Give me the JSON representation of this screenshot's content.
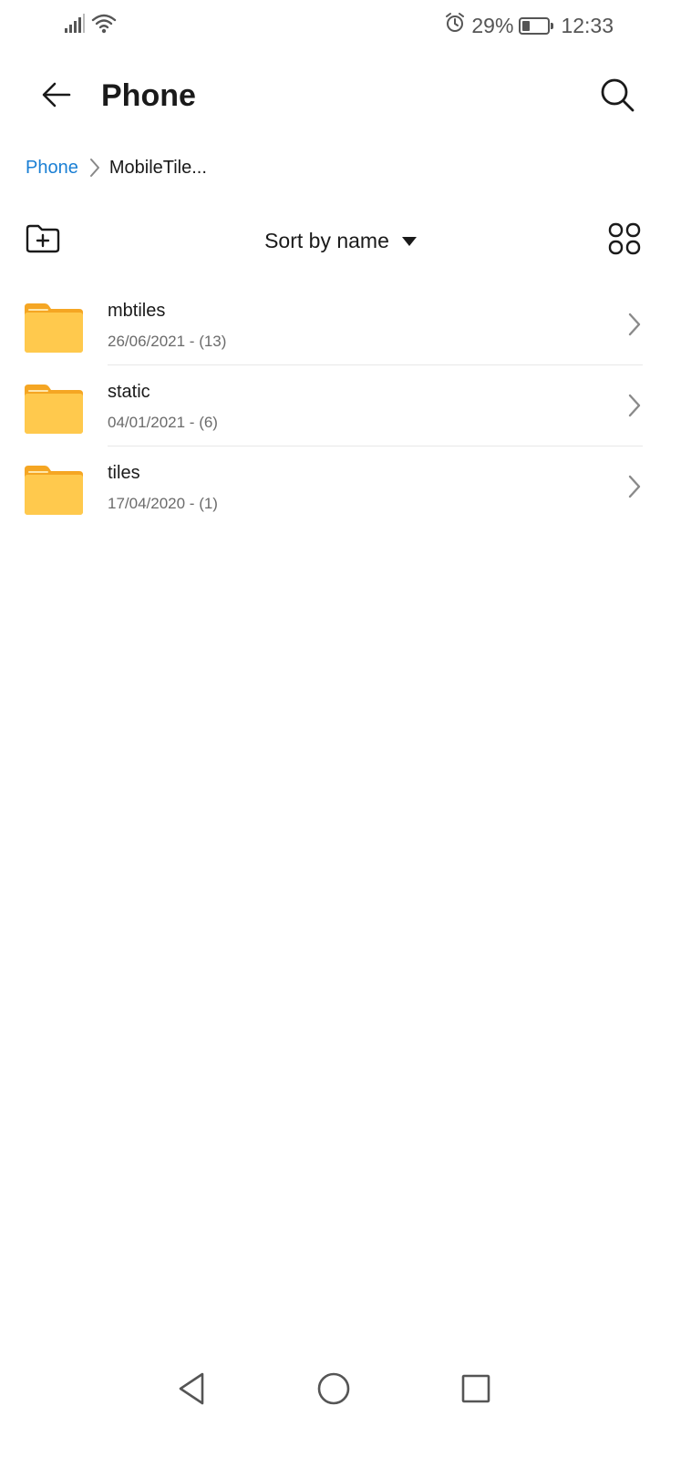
{
  "status_bar": {
    "battery_percent_label": "29%",
    "battery_level": 0.29,
    "time": "12:33",
    "icons": [
      "signal-icon",
      "wifi-icon",
      "alarm-icon",
      "battery-icon"
    ]
  },
  "app_bar": {
    "title": "Phone",
    "back_icon": "arrow-left-icon",
    "search_icon": "search-icon"
  },
  "breadcrumb": {
    "root": "Phone",
    "current": "MobileTile..."
  },
  "toolbar": {
    "sort_label": "Sort by name",
    "new_folder_icon": "new-folder-icon",
    "view_toggle_icon": "grid-view-icon"
  },
  "files": [
    {
      "name": "mbtiles",
      "meta": "26/06/2021 - (13)"
    },
    {
      "name": "static",
      "meta": "04/01/2021 - (6)"
    },
    {
      "name": "tiles",
      "meta": "17/04/2020 - (1)"
    }
  ],
  "nav_bar": {
    "icons": [
      "nav-back-icon",
      "nav-home-icon",
      "nav-recents-icon"
    ]
  },
  "colors": {
    "accent": "#1a7fd4",
    "folder": "#FFC94D",
    "folder_tab": "#F5A623",
    "text_primary": "#1a1a1a",
    "text_secondary": "#6b6b6b"
  }
}
